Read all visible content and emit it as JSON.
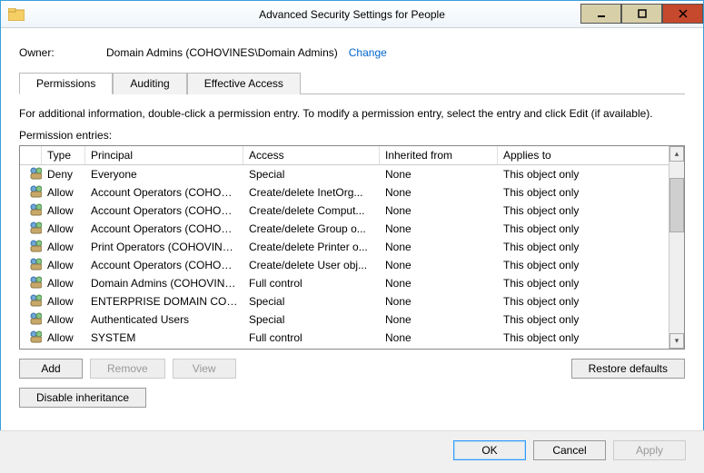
{
  "window": {
    "title": "Advanced Security Settings for People"
  },
  "owner": {
    "label": "Owner:",
    "value": "Domain Admins (COHOVINES\\Domain Admins)",
    "change": "Change"
  },
  "tabs": {
    "permissions": "Permissions",
    "auditing": "Auditing",
    "effective": "Effective Access"
  },
  "info": "For additional information, double-click a permission entry. To modify a permission entry, select the entry and click Edit (if available).",
  "entries_label": "Permission entries:",
  "columns": {
    "type": "Type",
    "principal": "Principal",
    "access": "Access",
    "inherited": "Inherited from",
    "applies": "Applies to"
  },
  "rows": [
    {
      "type": "Deny",
      "principal": "Everyone",
      "access": "Special",
      "inherited": "None",
      "applies": "This object only"
    },
    {
      "type": "Allow",
      "principal": "Account Operators (COHOVI...",
      "access": "Create/delete InetOrg...",
      "inherited": "None",
      "applies": "This object only"
    },
    {
      "type": "Allow",
      "principal": "Account Operators (COHOVI...",
      "access": "Create/delete Comput...",
      "inherited": "None",
      "applies": "This object only"
    },
    {
      "type": "Allow",
      "principal": "Account Operators (COHOVI...",
      "access": "Create/delete Group o...",
      "inherited": "None",
      "applies": "This object only"
    },
    {
      "type": "Allow",
      "principal": "Print Operators (COHOVINES...",
      "access": "Create/delete Printer o...",
      "inherited": "None",
      "applies": "This object only"
    },
    {
      "type": "Allow",
      "principal": "Account Operators (COHOVI...",
      "access": "Create/delete User obj...",
      "inherited": "None",
      "applies": "This object only"
    },
    {
      "type": "Allow",
      "principal": "Domain Admins (COHOVINE...",
      "access": "Full control",
      "inherited": "None",
      "applies": "This object only"
    },
    {
      "type": "Allow",
      "principal": "ENTERPRISE DOMAIN CONT...",
      "access": "Special",
      "inherited": "None",
      "applies": "This object only"
    },
    {
      "type": "Allow",
      "principal": "Authenticated Users",
      "access": "Special",
      "inherited": "None",
      "applies": "This object only"
    },
    {
      "type": "Allow",
      "principal": "SYSTEM",
      "access": "Full control",
      "inherited": "None",
      "applies": "This object only"
    }
  ],
  "buttons": {
    "add": "Add",
    "remove": "Remove",
    "view": "View",
    "restore": "Restore defaults",
    "disable": "Disable inheritance",
    "ok": "OK",
    "cancel": "Cancel",
    "apply": "Apply"
  }
}
